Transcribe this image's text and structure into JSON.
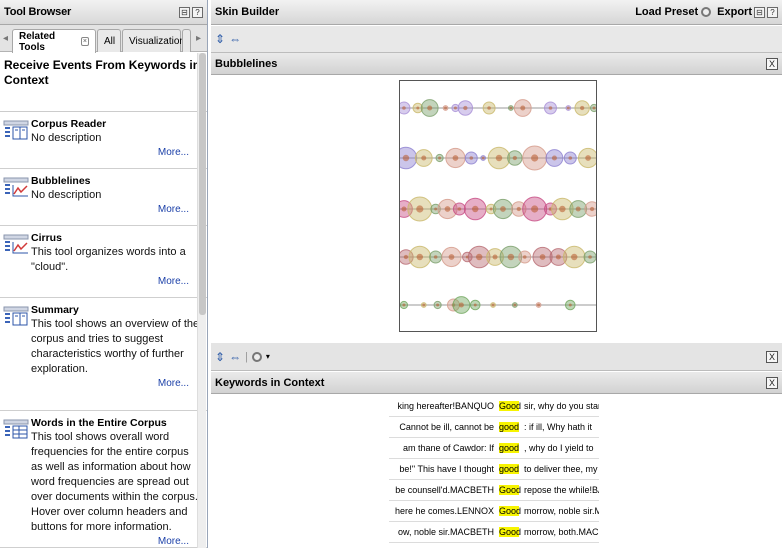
{
  "left_panel": {
    "title": "Tool Browser",
    "btn_collapse": "⊟",
    "btn_help": "?",
    "tabs": [
      {
        "label": "Related Tools",
        "active": true
      },
      {
        "label": "All",
        "active": false
      },
      {
        "label": "Visualization",
        "active": false
      }
    ],
    "tab_close": "×",
    "heading": "Receive Events From Keywords in Context",
    "tools": [
      {
        "name": "Corpus Reader",
        "description": "No description",
        "more": "More...",
        "icon": "book-icon"
      },
      {
        "name": "Bubblelines",
        "description": "No description",
        "more": "More...",
        "icon": "chart-icon"
      },
      {
        "name": "Cirrus",
        "description": "This tool organizes words into a \"cloud\".",
        "more": "More...",
        "icon": "chart-icon"
      },
      {
        "name": "Summary",
        "description": "This tool shows an overview of the corpus and tries to suggest characteristics worthy of further exploration.",
        "more": "More...",
        "icon": "book-icon"
      },
      {
        "name": "Words in the Entire Corpus",
        "description": "This tool shows overall word frequencies for the entire corpus as well as information about how word frequencies are spread out over documents within the corpus. Hover over column headers and buttons for more information.",
        "more": "More...",
        "icon": "table-icon"
      }
    ]
  },
  "right_panel": {
    "title": "Skin Builder",
    "load_preset": "Load Preset",
    "export": "Export",
    "btn_collapse": "⊟",
    "btn_help": "?",
    "bubblelines": {
      "title": "Bubblelines",
      "close": "X"
    },
    "kwic": {
      "title": "Keywords in Context",
      "close": "X",
      "toolbar_close": "X",
      "rows": [
        {
          "left": "king hereafter!BANQUO",
          "keyword": "Good",
          "right": "sir, why do you start"
        },
        {
          "left": "Cannot be ill, cannot be",
          "keyword": "good",
          "right": ": if ill, Why hath it"
        },
        {
          "left": "am thane of Cawdor: If",
          "keyword": "good",
          "right": ", why do I yield to"
        },
        {
          "left": "be!\" This have I thought",
          "keyword": "good",
          "right": "to deliver thee, my d"
        },
        {
          "left": "be counsell'd.MACBETH",
          "keyword": "Good",
          "right": "repose the while!BA"
        },
        {
          "left": "here he comes.LENNOX",
          "keyword": "Good",
          "right": "morrow, noble sir.M"
        },
        {
          "left": "ow, noble sir.MACBETH",
          "keyword": "Good",
          "right": "morrow, both.MACD"
        }
      ]
    }
  },
  "bubble_rows": [
    {
      "color": "#a78fd6",
      "bubbles": [
        0.02,
        0.05,
        0.09,
        0.04,
        0.15,
        0.07,
        0.23,
        0.02,
        0.28,
        0.03,
        0.33,
        0.06,
        0.45,
        0.05,
        0.56,
        0.02,
        0.62,
        0.07,
        0.76,
        0.05,
        0.85,
        0.02,
        0.92,
        0.06,
        0.98,
        0.03
      ]
    },
    {
      "color": "#8c7fd0",
      "bubbles": [
        0.03,
        0.09,
        0.12,
        0.07,
        0.2,
        0.03,
        0.28,
        0.08,
        0.36,
        0.05,
        0.42,
        0.02,
        0.5,
        0.09,
        0.58,
        0.06,
        0.68,
        0.1,
        0.78,
        0.07,
        0.86,
        0.05,
        0.95,
        0.08
      ]
    },
    {
      "color": "#c74b83",
      "bubbles": [
        0.02,
        0.07,
        0.1,
        0.1,
        0.18,
        0.04,
        0.24,
        0.08,
        0.3,
        0.05,
        0.38,
        0.09,
        0.46,
        0.04,
        0.52,
        0.08,
        0.6,
        0.06,
        0.68,
        0.1,
        0.76,
        0.05,
        0.82,
        0.09,
        0.9,
        0.07,
        0.97,
        0.06
      ]
    },
    {
      "color": "#b86a72",
      "bubbles": [
        0.03,
        0.06,
        0.1,
        0.09,
        0.18,
        0.05,
        0.26,
        0.08,
        0.34,
        0.04,
        0.4,
        0.09,
        0.48,
        0.07,
        0.56,
        0.09,
        0.63,
        0.05,
        0.72,
        0.08,
        0.8,
        0.07,
        0.88,
        0.09,
        0.96,
        0.05
      ]
    },
    {
      "color": "#6fa65d",
      "bubbles": [
        0.02,
        0.03,
        0.12,
        0.02,
        0.19,
        0.03,
        0.27,
        0.05,
        0.31,
        0.07,
        0.38,
        0.04,
        0.47,
        0.02,
        0.58,
        0.02,
        0.7,
        0.02,
        0.86,
        0.04
      ]
    }
  ],
  "colors": {
    "highlight": "#f7f400",
    "link": "#1a3fa8"
  }
}
